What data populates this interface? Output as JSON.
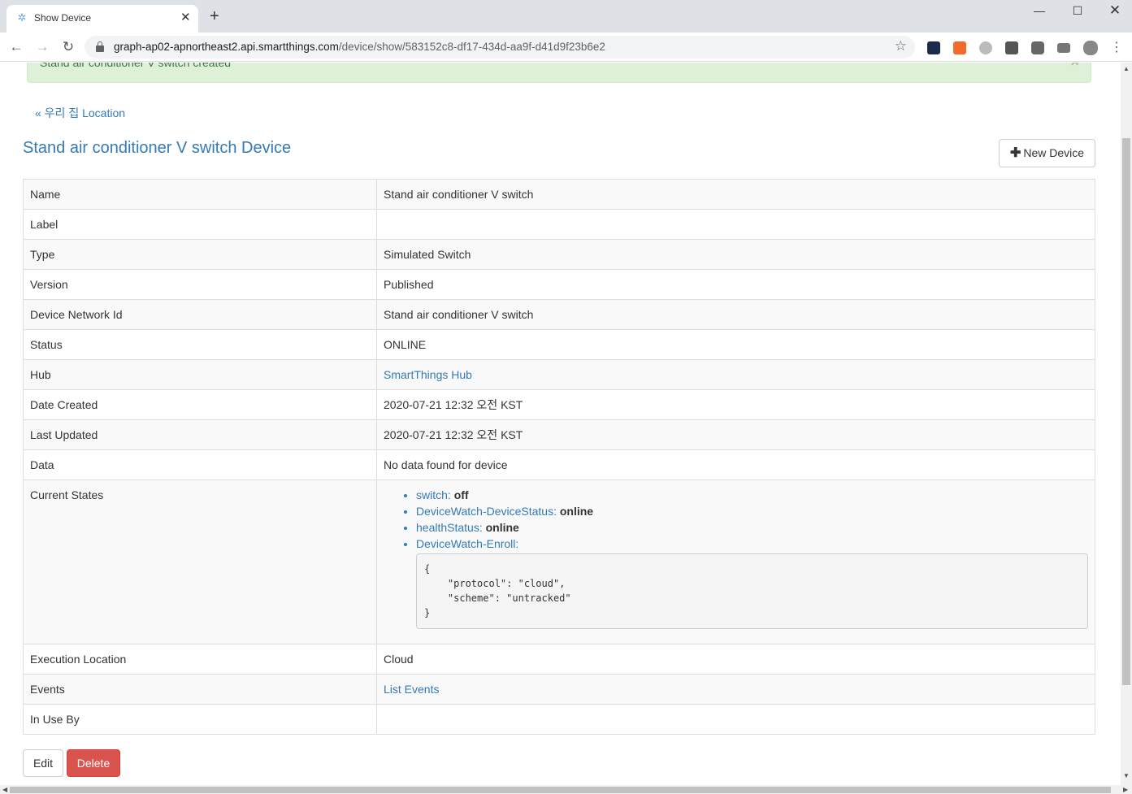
{
  "browser": {
    "tab_title": "Show Device",
    "url_host": "graph-ap02-apnortheast2.api.smartthings.com",
    "url_path": "/device/show/583152c8-df17-434d-aa9f-d41d9f23b6e2"
  },
  "alert": {
    "text": "Stand air conditioner V switch created"
  },
  "back_link": "« 우리 집 Location",
  "page_title": "Stand air conditioner V switch Device",
  "new_device_label": "New Device",
  "details": {
    "name": {
      "label": "Name",
      "value": "Stand air conditioner V switch"
    },
    "label": {
      "label": "Label",
      "value": ""
    },
    "type": {
      "label": "Type",
      "value": "Simulated Switch"
    },
    "version": {
      "label": "Version",
      "value": "Published"
    },
    "network_id": {
      "label": "Device Network Id",
      "value": "Stand air conditioner V switch"
    },
    "status": {
      "label": "Status",
      "value": "ONLINE"
    },
    "hub": {
      "label": "Hub",
      "value": "SmartThings Hub"
    },
    "date_created": {
      "label": "Date Created",
      "value": "2020-07-21 12:32 오전 KST"
    },
    "last_updated": {
      "label": "Last Updated",
      "value": "2020-07-21 12:32 오전 KST"
    },
    "data": {
      "label": "Data",
      "value": "No data found for device"
    },
    "current_states": {
      "label": "Current States",
      "items": [
        {
          "name": "switch",
          "value": "off"
        },
        {
          "name": "DeviceWatch-DeviceStatus",
          "value": "online"
        },
        {
          "name": "healthStatus",
          "value": "online"
        },
        {
          "name": "DeviceWatch-Enroll",
          "value": ""
        }
      ],
      "enroll_json": "{\n    \"protocol\": \"cloud\",\n    \"scheme\": \"untracked\"\n}"
    },
    "execution_location": {
      "label": "Execution Location",
      "value": "Cloud"
    },
    "events": {
      "label": "Events",
      "value": "List Events"
    },
    "in_use_by": {
      "label": "In Use By",
      "value": ""
    }
  },
  "actions": {
    "edit": "Edit",
    "delete": "Delete"
  }
}
